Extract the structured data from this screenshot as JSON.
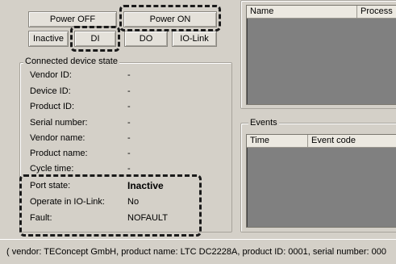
{
  "buttons": {
    "power_off": "Power OFF",
    "power_on": "Power ON",
    "inactive": "Inactive",
    "di": "DI",
    "do": "DO",
    "io_link": "IO-Link"
  },
  "device_state": {
    "title": "Connected device state",
    "fields": [
      {
        "label": "Vendor ID:",
        "value": "-"
      },
      {
        "label": "Device ID:",
        "value": "-"
      },
      {
        "label": "Product ID:",
        "value": "-"
      },
      {
        "label": "Serial number:",
        "value": "-"
      },
      {
        "label": "Vendor name:",
        "value": "-"
      },
      {
        "label": "Product name:",
        "value": "-"
      },
      {
        "label": "Cycle time:",
        "value": "-"
      }
    ],
    "port_state": {
      "label": "Port state:",
      "value": "Inactive"
    },
    "operate_iolink": {
      "label": "Operate in IO-Link:",
      "value": "No"
    },
    "fault": {
      "label": "Fault:",
      "value": "NOFAULT"
    }
  },
  "process_list": {
    "columns": [
      "Name",
      "Process"
    ]
  },
  "events": {
    "title": "Events",
    "columns": [
      "Time",
      "Event code"
    ]
  },
  "status_bar": {
    "text": "( vendor: TEConcept GmbH, product name: LTC DC2228A, product ID: 0001, serial number: 000"
  }
}
